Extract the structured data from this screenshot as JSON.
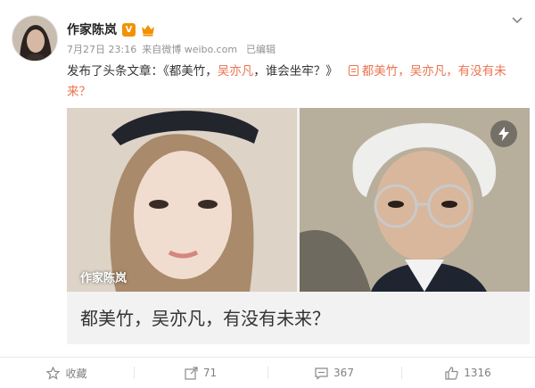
{
  "post": {
    "author": "作家陈岚",
    "timestamp": "7月27日 23:16",
    "source_prefix": "来自",
    "source": "微博 weibo.com",
    "edited": "已编辑",
    "text_prefix": "发布了头条文章：《都美竹，",
    "text_highlight": "吴亦凡",
    "text_suffix": "，谁会坐牢？》",
    "article_link": "都美竹，吴亦凡，有没有未来？"
  },
  "card": {
    "watermark": "作家陈岚",
    "title": "都美竹，吴亦凡，有没有未来？"
  },
  "actions": {
    "favorite": "收藏",
    "repost": "71",
    "comment": "367",
    "like": "1316"
  },
  "icons": [
    "chevron-down-icon",
    "v-badge-icon",
    "member-icon",
    "article-icon",
    "lightning-icon",
    "star-icon",
    "repost-icon",
    "comment-icon",
    "like-icon"
  ],
  "colors": {
    "accent": "#eb7350",
    "badge": "#f29200",
    "muted": "#939393"
  }
}
